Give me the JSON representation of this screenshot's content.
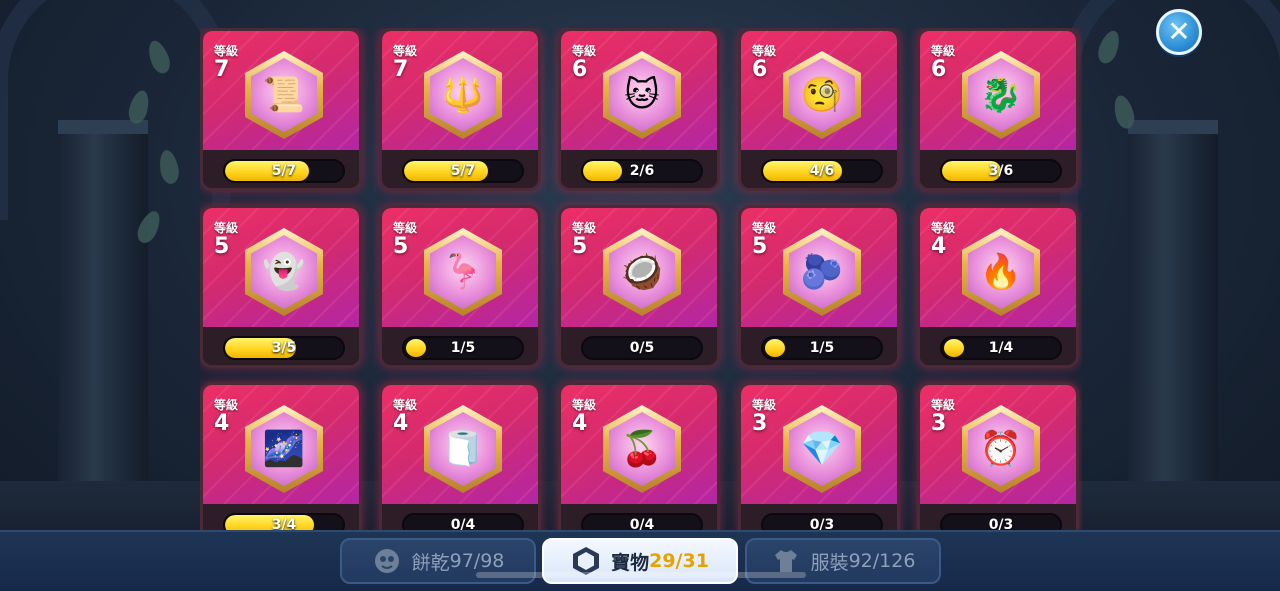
{
  "close": {
    "symbol": "✕"
  },
  "cards": [
    {
      "level_label": "等級",
      "level": "7",
      "progress": "5/7",
      "fill": 0.714,
      "icon": "scroll-treasure-icon",
      "glyph": "📜"
    },
    {
      "level_label": "等級",
      "level": "7",
      "progress": "5/7",
      "fill": 0.714,
      "icon": "crystal-crown-icon",
      "glyph": "🔱"
    },
    {
      "level_label": "等級",
      "level": "6",
      "progress": "2/6",
      "fill": 0.333,
      "icon": "cat-balloon-icon",
      "glyph": "🐱"
    },
    {
      "level_label": "等級",
      "level": "6",
      "progress": "4/6",
      "fill": 0.667,
      "icon": "monocle-icon",
      "glyph": "🧐"
    },
    {
      "level_label": "等級",
      "level": "6",
      "progress": "3/6",
      "fill": 0.5,
      "icon": "blue-dragon-icon",
      "glyph": "🐉"
    },
    {
      "level_label": "等級",
      "level": "5",
      "progress": "3/5",
      "fill": 0.6,
      "icon": "ghost-ornament-icon",
      "glyph": "👻"
    },
    {
      "level_label": "等級",
      "level": "5",
      "progress": "1/5",
      "fill": 0.2,
      "icon": "flamingo-float-icon",
      "glyph": "🦩"
    },
    {
      "level_label": "等級",
      "level": "5",
      "progress": "0/5",
      "fill": 0,
      "icon": "coconut-icon",
      "glyph": "🥥"
    },
    {
      "level_label": "等級",
      "level": "5",
      "progress": "1/5",
      "fill": 0.2,
      "icon": "radish-icon",
      "glyph": "🫐"
    },
    {
      "level_label": "等級",
      "level": "4",
      "progress": "1/4",
      "fill": 0.25,
      "icon": "flame-crown-icon",
      "glyph": "🔥"
    },
    {
      "level_label": "等級",
      "level": "4",
      "progress": "3/4",
      "fill": 0.75,
      "icon": "starry-pouch-icon",
      "glyph": "🌌"
    },
    {
      "level_label": "等級",
      "level": "4",
      "progress": "0/4",
      "fill": 0,
      "icon": "mummy-doll-icon",
      "glyph": "🧻"
    },
    {
      "level_label": "等級",
      "level": "4",
      "progress": "0/4",
      "fill": 0,
      "icon": "berry-wreath-icon",
      "glyph": "🍒"
    },
    {
      "level_label": "等級",
      "level": "3",
      "progress": "0/3",
      "fill": 0,
      "icon": "ice-crystal-icon",
      "glyph": "💎"
    },
    {
      "level_label": "等級",
      "level": "3",
      "progress": "0/3",
      "fill": 0,
      "icon": "alarm-clock-icon",
      "glyph": "⏰"
    }
  ],
  "tabs": [
    {
      "label": "餅乾",
      "count": "97/98",
      "icon": "cookie-icon",
      "active": false
    },
    {
      "label": "寶物",
      "count": "29/31",
      "icon": "treasure-hexagon-icon",
      "active": true
    },
    {
      "label": "服裝",
      "count": "92/126",
      "icon": "costume-shirt-icon",
      "active": false
    }
  ],
  "colors": {
    "card_gradient_top": "#ec2f66",
    "card_gradient_bottom": "#b226a6",
    "bar_fill": "#ffd21c",
    "active_count": "#e5a300"
  }
}
